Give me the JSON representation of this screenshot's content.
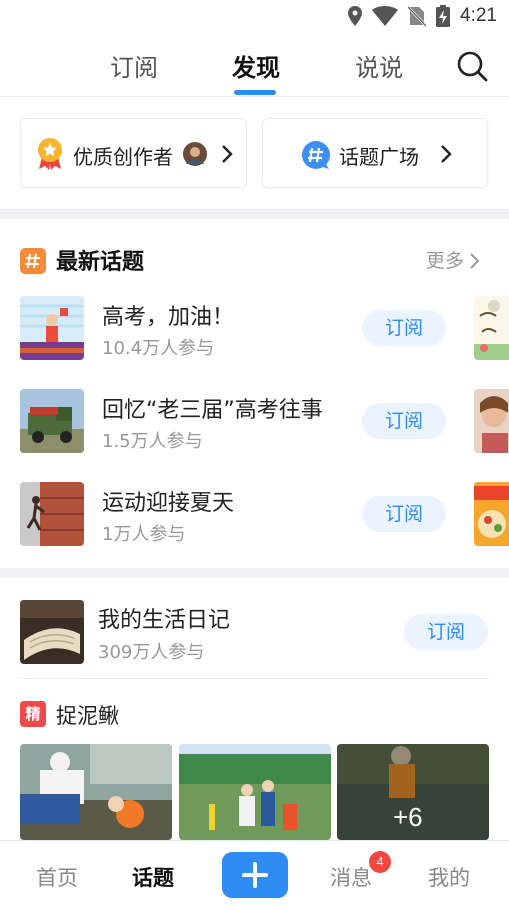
{
  "status_bar": {
    "time": "4:21",
    "icons": [
      "location-icon",
      "wifi-icon",
      "no-sim-icon",
      "battery-charging-icon"
    ]
  },
  "top_nav": {
    "tabs": [
      {
        "label": "订阅",
        "active": false
      },
      {
        "label": "发现",
        "active": true
      },
      {
        "label": "说说",
        "active": false
      }
    ],
    "search_icon": "search-icon",
    "accent_color": "#2f8cf3"
  },
  "entries": [
    {
      "label": "优质创作者",
      "icon": "star-medal-icon"
    },
    {
      "label": "话题广场",
      "icon": "hashtag-icon"
    }
  ],
  "latest_topics": {
    "title": "最新话题",
    "more_label": "更多",
    "items": [
      {
        "title": "高考，加油！",
        "count": "10.4万人参与",
        "button": "订阅"
      },
      {
        "title": "回忆“老三届”高考往事",
        "count": "1.5万人参与",
        "button": "订阅"
      },
      {
        "title": "运动迎接夏天",
        "count": "1万人参与",
        "button": "订阅"
      }
    ]
  },
  "diary": {
    "title": "我的生活日记",
    "count": "309万人参与",
    "button": "订阅"
  },
  "featured": {
    "tag": "精",
    "title": "捉泥鳅",
    "more_photos": "+6"
  },
  "bottom_nav": {
    "items": [
      {
        "label": "首页",
        "active": false
      },
      {
        "label": "话题",
        "active": true
      },
      {
        "label": "消息",
        "active": false
      },
      {
        "label": "我的",
        "active": false
      }
    ],
    "add_icon": "plus-icon",
    "message_badge": "4"
  }
}
